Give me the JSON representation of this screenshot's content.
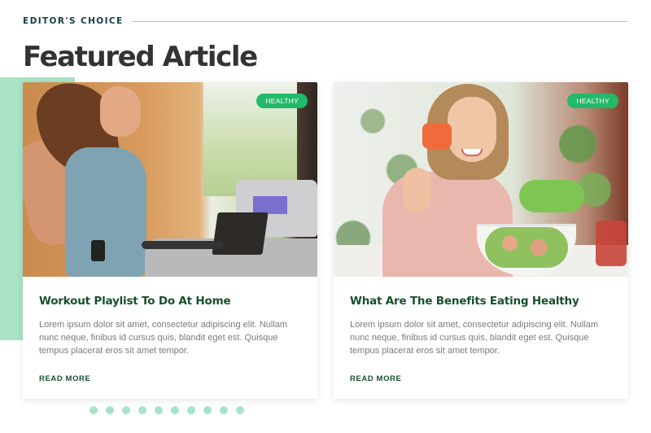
{
  "header": {
    "eyebrow": "EDITOR'S CHOICE",
    "title": "Featured Article"
  },
  "colors": {
    "accent_green": "#23b96a",
    "light_green": "#a8e3c6",
    "title_green": "#17502e",
    "eyebrow_navy": "#163a45"
  },
  "articles": [
    {
      "badge": "HEALTHY",
      "image_alt": "Woman running on a treadmill at home",
      "title": "Workout Playlist To Do At Home",
      "excerpt": "Lorem ipsum dolor sit amet, consectetur adipiscing elit. Nullam nunc neque, finibus id cursus quis, blandit eget est. Quisque tempus placerat eros sit amet tempor.",
      "cta": "READ MORE"
    },
    {
      "badge": "HEALTHY",
      "image_alt": "Smiling woman eating a salad",
      "title": "What Are The Benefits Eating Healthy",
      "excerpt": "Lorem ipsum dolor sit amet, consectetur adipiscing elit. Nullam nunc neque, finibus id cursus quis, blandit eget est. Quisque tempus placerat eros sit amet tempor.",
      "cta": "READ MORE"
    }
  ],
  "pagination": {
    "dot_count": 10
  }
}
